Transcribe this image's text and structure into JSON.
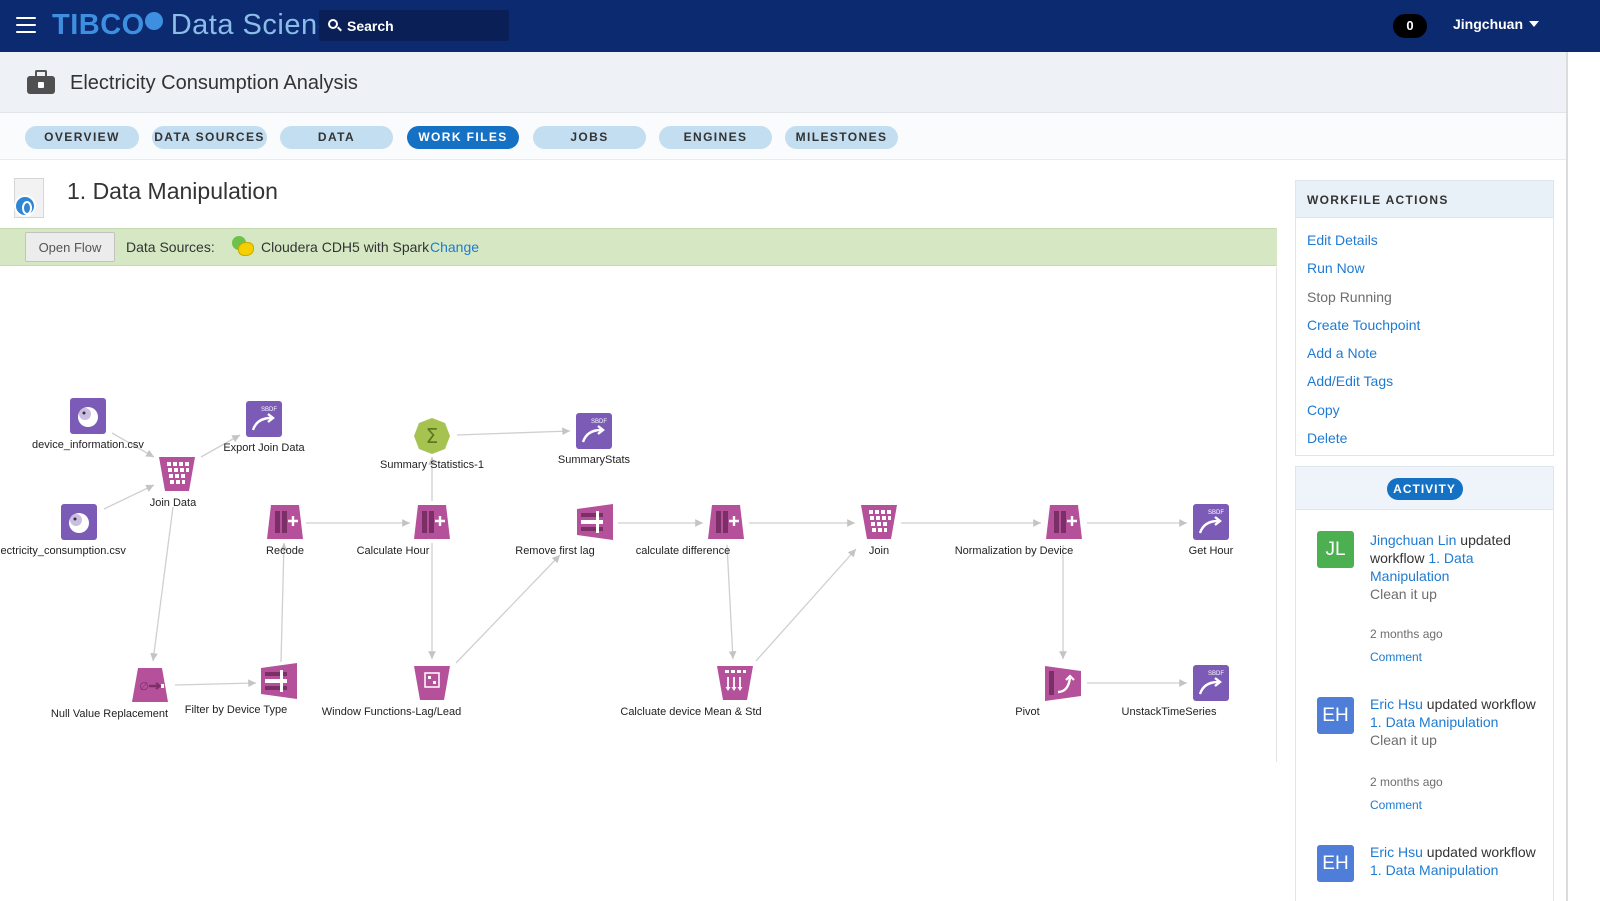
{
  "topbar": {
    "brand": "TIBCO",
    "product": "Data Science",
    "search_placeholder": "Search",
    "notifications": "0",
    "user": "Jingchuan",
    "colors": {
      "bar": "#0b2a6f",
      "accent": "#1571c4"
    }
  },
  "project": {
    "title": "Electricity Consumption Analysis"
  },
  "tabs": [
    {
      "label": "OVERVIEW",
      "active": false
    },
    {
      "label": "DATA SOURCES",
      "active": false
    },
    {
      "label": "DATA",
      "active": false
    },
    {
      "label": "WORK FILES",
      "active": true
    },
    {
      "label": "JOBS",
      "active": false
    },
    {
      "label": "ENGINES",
      "active": false
    },
    {
      "label": "MILESTONES",
      "active": false
    }
  ],
  "workfile": {
    "title": "1. Data Manipulation",
    "open_flow_label": "Open Flow",
    "data_sources_label": "Data Sources:",
    "data_source_name": "Cloudera CDH5 with Spark",
    "change_label": "Change"
  },
  "flow": {
    "nodes": [
      {
        "id": "n1",
        "label": "device_information.csv",
        "icon": "hadoop-elephant-icon",
        "color": "#7b5bb5"
      },
      {
        "id": "n2",
        "label": "lectricity_consumption.csv",
        "icon": "hadoop-elephant-icon",
        "color": "#7b5bb5"
      },
      {
        "id": "n3",
        "label": "Join Data",
        "icon": "join-grid-icon",
        "color": "#b5509a"
      },
      {
        "id": "n4",
        "label": "Export Join Data",
        "icon": "sbdf-export-icon",
        "color": "#7b5bb5"
      },
      {
        "id": "n5",
        "label": "Summary Statistics-1",
        "icon": "sigma-icon",
        "color": "#a6c352"
      },
      {
        "id": "n6",
        "label": "SummaryStats",
        "icon": "sbdf-export-icon",
        "color": "#7b5bb5"
      },
      {
        "id": "n7",
        "label": "Recode",
        "icon": "column-add-icon",
        "color": "#b5509a"
      },
      {
        "id": "n8",
        "label": "Calculate Hour",
        "icon": "column-add-icon",
        "color": "#b5509a"
      },
      {
        "id": "n9",
        "label": "Remove first lag",
        "icon": "row-filter-icon",
        "color": "#b5509a"
      },
      {
        "id": "n10",
        "label": "calculate difference",
        "icon": "column-add-icon",
        "color": "#b5509a"
      },
      {
        "id": "n11",
        "label": "Join",
        "icon": "join-grid-icon",
        "color": "#b5509a"
      },
      {
        "id": "n12",
        "label": "Normalization by Device",
        "icon": "column-add-icon",
        "color": "#b5509a"
      },
      {
        "id": "n13",
        "label": "Get Hour",
        "icon": "sbdf-export-icon",
        "color": "#7b5bb5"
      },
      {
        "id": "n14",
        "label": "Null Value Replacement",
        "icon": "null-replace-icon",
        "color": "#b5509a"
      },
      {
        "id": "n15",
        "label": "Filter by Device Type",
        "icon": "row-filter-icon",
        "color": "#b5509a"
      },
      {
        "id": "n16",
        "label": "Window Functions-Lag/Lead",
        "icon": "window-function-icon",
        "color": "#b5509a"
      },
      {
        "id": "n17",
        "label": "Calcluate device Mean & Std",
        "icon": "aggregate-icon",
        "color": "#b5509a"
      },
      {
        "id": "n18",
        "label": "Pivot",
        "icon": "pivot-icon",
        "color": "#b5509a"
      },
      {
        "id": "n19",
        "label": "UnstackTimeSeries",
        "icon": "sbdf-export-icon",
        "color": "#7b5bb5"
      }
    ]
  },
  "sbdf_tag": "SBDF",
  "actions": {
    "title": "WORKFILE ACTIONS",
    "items": [
      {
        "label": "Edit Details",
        "enabled": true
      },
      {
        "label": "Run Now",
        "enabled": true
      },
      {
        "label": "Stop Running",
        "enabled": false
      },
      {
        "label": "Create Touchpoint",
        "enabled": true
      },
      {
        "label": "Add a Note",
        "enabled": true
      },
      {
        "label": "Add/Edit Tags",
        "enabled": true
      },
      {
        "label": "Copy",
        "enabled": true
      },
      {
        "label": "Delete",
        "enabled": true
      }
    ]
  },
  "activity": {
    "title": "ACTIVITY",
    "items": [
      {
        "initials": "JL",
        "color": "#4caf50",
        "user": "Jingchuan Lin",
        "verb": "updated workflow",
        "target": "1. Data Manipulation",
        "note": "Clean it up",
        "time": "2 months ago",
        "comment": "Comment"
      },
      {
        "initials": "EH",
        "color": "#4f7ed8",
        "user": "Eric Hsu",
        "verb": "updated workflow",
        "target": "1. Data Manipulation",
        "note": "Clean it up",
        "time": "2 months ago",
        "comment": "Comment"
      },
      {
        "initials": "EH",
        "color": "#4f7ed8",
        "user": "Eric Hsu",
        "verb": "updated workflow",
        "target": "1. Data Manipulation",
        "note": "",
        "time": "",
        "comment": ""
      }
    ]
  }
}
